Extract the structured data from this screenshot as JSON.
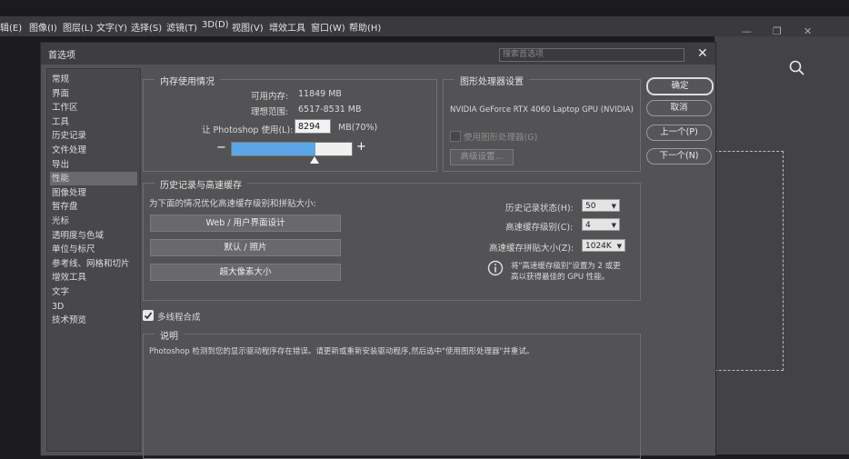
{
  "menubar": [
    "辑(E)",
    "图像(I)",
    "图层(L)",
    "文字(Y)",
    "选择(S)",
    "滤镜(T)",
    "3D(D)",
    "视图(V)",
    "增效工具",
    "窗口(W)",
    "帮助(H)"
  ],
  "window_controls": [
    "—",
    "❐",
    "✕"
  ],
  "dialog": {
    "title": "首选项",
    "search_placeholder": "搜索首选项",
    "close": "✕"
  },
  "sidebar": [
    {
      "label": "常规"
    },
    {
      "label": "界面"
    },
    {
      "label": "工作区"
    },
    {
      "label": "工具"
    },
    {
      "label": "历史记录"
    },
    {
      "label": "文件处理"
    },
    {
      "label": "导出"
    },
    {
      "label": "性能",
      "active": true
    },
    {
      "label": "图像处理"
    },
    {
      "label": "暂存盘"
    },
    {
      "label": "光标"
    },
    {
      "label": "透明度与色域"
    },
    {
      "label": "单位与标尺"
    },
    {
      "label": "参考线、网格和切片"
    },
    {
      "label": "增效工具"
    },
    {
      "label": "文字"
    },
    {
      "label": "3D"
    },
    {
      "label": "技术预览"
    }
  ],
  "memory": {
    "title": "内存使用情况",
    "available_label": "可用内存:",
    "available_value": "11849 MB",
    "ideal_label": "理想范围:",
    "ideal_value": "6517-8531 MB",
    "let_label": "让 Photoshop 使用(L):",
    "value": "8294",
    "unit": "MB(70%)",
    "minus": "−",
    "plus": "+",
    "usage_fraction": 0.7
  },
  "gpu": {
    "title": "图形处理器设置",
    "device": "NVIDIA GeForce RTX 4060 Laptop GPU (NVIDIA)",
    "use_gpu_label": "使用图形处理器(G)",
    "advanced_button": "高级设置..."
  },
  "history": {
    "title": "历史记录与高速缓存",
    "optimize_text": "为下面的情况优化高速缓存级别和拼贴大小:",
    "buttons": [
      "Web / 用户界面设计",
      "默认 / 照片",
      "超大像素大小"
    ],
    "history_states_label": "历史记录状态(H):",
    "history_states_value": "50",
    "cache_levels_label": "高速缓存级别(C):",
    "cache_levels_value": "4",
    "tile_size_label": "高速缓存拼贴大小(Z):",
    "tile_size_value": "1024K",
    "info_line1": "将\"高速缓存级别\"设置为 2 或更",
    "info_line2": "高以获得最佳的 GPU 性能。"
  },
  "multithread": {
    "label": "多线程合成",
    "checked": true
  },
  "description": {
    "title": "说明",
    "text": "Photoshop 检测到您的显示驱动程序存在错误。请更新或重新安装驱动程序,然后选中\"使用图形处理器\"并重试。"
  },
  "right_buttons": {
    "ok": "确定",
    "cancel": "取消",
    "prev": "上一个(P)",
    "next": "下一个(N)"
  },
  "colors": {
    "slider_fill": "#5aa6e6",
    "dialog_bg": "#535355"
  }
}
